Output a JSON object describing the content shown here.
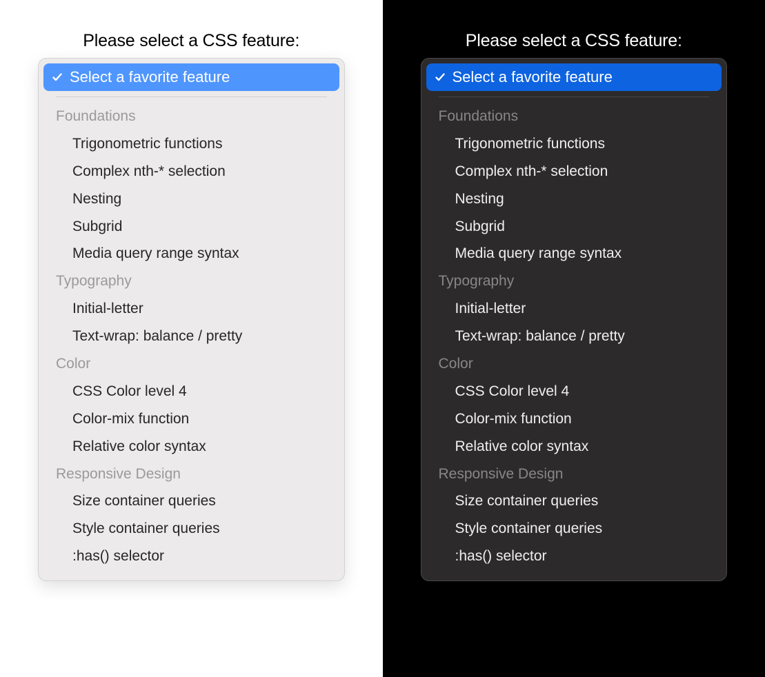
{
  "prompt": "Please select a CSS feature:",
  "colors": {
    "light_accent": "#4f95fe",
    "dark_accent": "#0d63e0"
  },
  "select": {
    "selected_label": "Select a favorite feature",
    "groups": [
      {
        "label": "Foundations",
        "options": [
          "Trigonometric functions",
          "Complex nth-* selection",
          "Nesting",
          "Subgrid",
          "Media query range syntax"
        ]
      },
      {
        "label": "Typography",
        "options": [
          "Initial-letter",
          "Text-wrap: balance / pretty"
        ]
      },
      {
        "label": "Color",
        "options": [
          "CSS Color level 4",
          "Color-mix function",
          "Relative color syntax"
        ]
      },
      {
        "label": "Responsive Design",
        "options": [
          "Size container queries",
          "Style container queries",
          ":has() selector"
        ]
      }
    ]
  }
}
